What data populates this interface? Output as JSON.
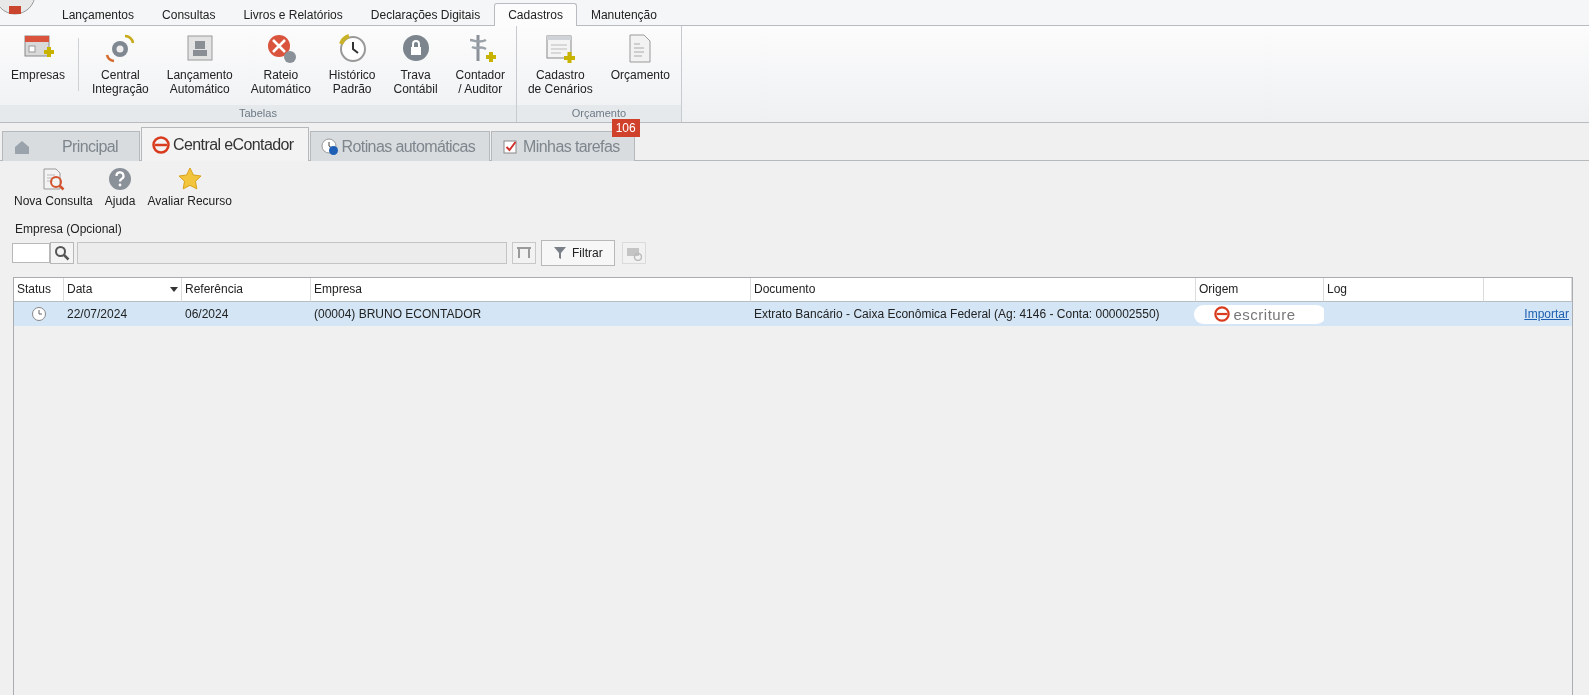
{
  "menu_tabs": [
    {
      "label": "Lançamentos",
      "selected": false
    },
    {
      "label": "Consultas",
      "selected": false
    },
    {
      "label": "Livros e Relatórios",
      "selected": false
    },
    {
      "label": "Declarações Digitais",
      "selected": false
    },
    {
      "label": "Cadastros",
      "selected": true
    },
    {
      "label": "Manutenção",
      "selected": false
    }
  ],
  "ribbon_groups": [
    {
      "label": "Tabelas",
      "buttons": [
        {
          "lines": [
            "Empresas"
          ]
        },
        {
          "lines": [
            "Central",
            "Integração"
          ]
        },
        {
          "lines": [
            "Lançamento",
            "Automático"
          ]
        },
        {
          "lines": [
            "Rateio",
            "Automático"
          ]
        },
        {
          "lines": [
            "Histórico",
            "Padrão"
          ]
        },
        {
          "lines": [
            "Trava",
            "Contábil"
          ]
        },
        {
          "lines": [
            "Contador",
            "/ Auditor"
          ]
        }
      ]
    },
    {
      "label": "Orçamento",
      "buttons": [
        {
          "lines": [
            "Cadastro",
            "de Cenários"
          ]
        },
        {
          "lines": [
            "Orçamento"
          ]
        }
      ]
    }
  ],
  "doc_tabs": [
    {
      "label": "Principal",
      "selected": false
    },
    {
      "label": "Central eContador",
      "selected": true
    },
    {
      "label": "Rotinas automáticas",
      "selected": false
    },
    {
      "label": "Minhas tarefas",
      "selected": false,
      "badge": "106"
    }
  ],
  "toolbar": [
    {
      "label": "Nova Consulta"
    },
    {
      "label": "Ajuda"
    },
    {
      "label": "Avaliar Recurso"
    }
  ],
  "filter": {
    "label": "Empresa (Opcional)",
    "button": "Filtrar"
  },
  "table": {
    "columns": [
      "Status",
      "Data",
      "Referência",
      "Empresa",
      "Documento",
      "Origem",
      "Log",
      ""
    ],
    "rows": [
      {
        "selected": true,
        "data": "22/07/2024",
        "referencia": "06/2024",
        "empresa": "(00004) BRUNO ECONTADOR",
        "documento": "Extrato Bancário - Caixa Econômica Federal (Ag: 4146 - Conta: 000002550)",
        "origem": "escriture",
        "action": "Importar"
      }
    ]
  }
}
